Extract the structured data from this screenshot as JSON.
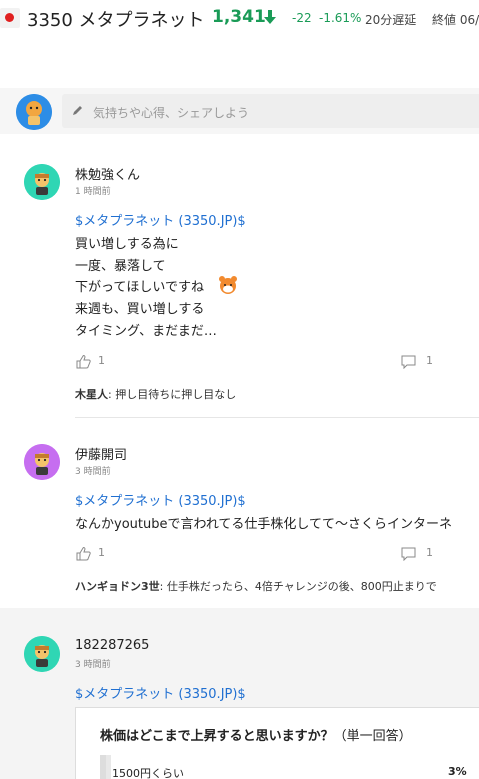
{
  "header": {
    "stock_name": "3350 メタプラネット",
    "price": "1,341",
    "change": "-22",
    "change_pct": "-1.61%",
    "delay": "20分遅延",
    "close_label": "終値 06/"
  },
  "composer": {
    "placeholder": "気持ちや心得、シェアしよう"
  },
  "posts": [
    {
      "author": "株勉強くん",
      "time": "1 時間前",
      "ticker": "$メタプラネット (3350.JP)$",
      "lines": [
        "買い増しする為に",
        "一度、暴落して",
        "下がってほしいですね",
        "来週も、買い増しする",
        "タイミング、まだまだ…"
      ],
      "likes": "1",
      "comments": "1",
      "reply_author": "木星人",
      "reply_text": ": 押し目待ちに押し目なし"
    },
    {
      "author": "伊藤開司",
      "time": "3 時間前",
      "ticker": "$メタプラネット (3350.JP)$",
      "lines": [
        "なんかyoutubeで言われてる仕手株化してて〜さくらインターネ"
      ],
      "likes": "1",
      "comments": "1",
      "reply_author": "ハンギョドン3世",
      "reply_text": ": 仕手株だったら、4倍チャレンジの後、800円止まりで"
    },
    {
      "author": "182287265",
      "time": "3 時間前",
      "ticker": "$メタプラネット (3350.JP)$",
      "poll_question": "株価はどこまで上昇すると思いますか？",
      "poll_note": "（単一回答）",
      "poll_option": "1500円くらい",
      "poll_pct": "3%",
      "poll_fraction": 0.03
    }
  ],
  "colors": {
    "up_down_green": "#1a9b57",
    "ticker_blue": "#1f6fd1"
  }
}
